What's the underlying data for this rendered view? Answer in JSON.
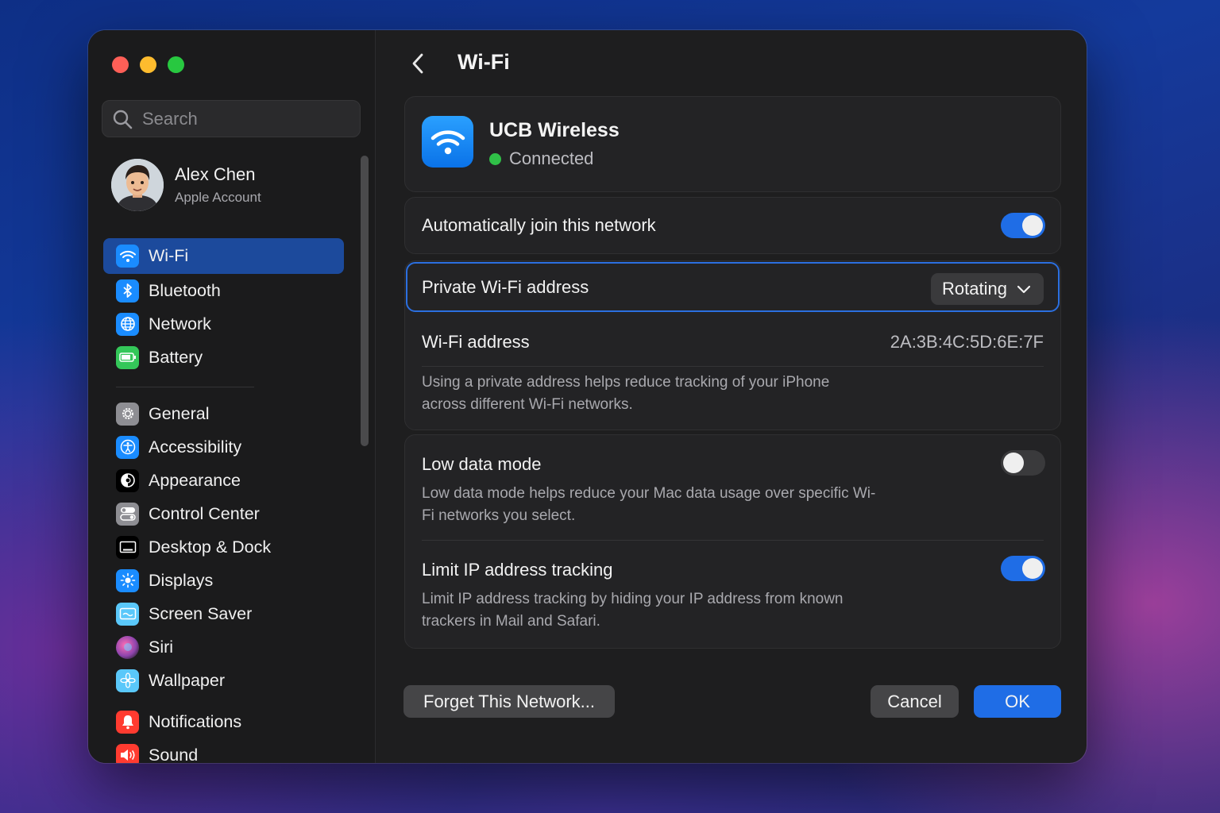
{
  "search": {
    "placeholder": "Search"
  },
  "account": {
    "name": "Alex Chen",
    "subtitle": "Apple Account"
  },
  "sidebar": {
    "items": [
      {
        "label": "Wi-Fi",
        "icon": "wifi-icon",
        "color": "#1a8cff",
        "active": true
      },
      {
        "label": "Bluetooth",
        "icon": "bluetooth-icon",
        "color": "#1a8cff"
      },
      {
        "label": "Network",
        "icon": "globe-icon",
        "color": "#1a8cff"
      },
      {
        "label": "Battery",
        "icon": "battery-icon",
        "color": "#34c759"
      },
      {
        "label": "General",
        "icon": "gear-icon",
        "color": "#8e8e93"
      },
      {
        "label": "Accessibility",
        "icon": "accessibility-icon",
        "color": "#1a8cff"
      },
      {
        "label": "Appearance",
        "icon": "appearance-icon",
        "color": "#000000"
      },
      {
        "label": "Control Center",
        "icon": "control-center-icon",
        "color": "#8e8e93"
      },
      {
        "label": "Desktop & Dock",
        "icon": "dock-icon",
        "color": "#000000"
      },
      {
        "label": "Displays",
        "icon": "sun-icon",
        "color": "#1a8cff"
      },
      {
        "label": "Screen Saver",
        "icon": "screen-saver-icon",
        "color": "#5ac8fa"
      },
      {
        "label": "Siri",
        "icon": "siri-icon",
        "color": "#af52de"
      },
      {
        "label": "Wallpaper",
        "icon": "flower-icon",
        "color": "#5ac8fa"
      },
      {
        "label": "Notifications",
        "icon": "bell-icon",
        "color": "#ff3b30"
      },
      {
        "label": "Sound",
        "icon": "speaker-icon",
        "color": "#ff3b30"
      }
    ]
  },
  "header": {
    "title": "Wi-Fi"
  },
  "network": {
    "name": "UCB Wireless",
    "status": "Connected",
    "status_color": "#30c048"
  },
  "auto_join": {
    "label": "Automatically join this network",
    "enabled": true
  },
  "private_address": {
    "label": "Private Wi-Fi address",
    "selected": "Rotating"
  },
  "wifi_address": {
    "label": "Wi-Fi address",
    "value": "2A:3B:4C:5D:6E:7F",
    "description": "Using a private address helps reduce tracking of your iPhone across different Wi-Fi networks."
  },
  "low_data": {
    "label": "Low data mode",
    "enabled": false,
    "description": "Low data mode helps reduce your Mac data usage over specific Wi-Fi networks you select."
  },
  "limit_ip": {
    "label": "Limit IP address tracking",
    "enabled": true,
    "description": "Limit IP address tracking by hiding your IP address from known trackers in Mail and Safari."
  },
  "buttons": {
    "forget": "Forget This Network...",
    "cancel": "Cancel",
    "ok": "OK"
  },
  "colors": {
    "accent": "#1f6de6",
    "selection": "#1c4a9c"
  }
}
